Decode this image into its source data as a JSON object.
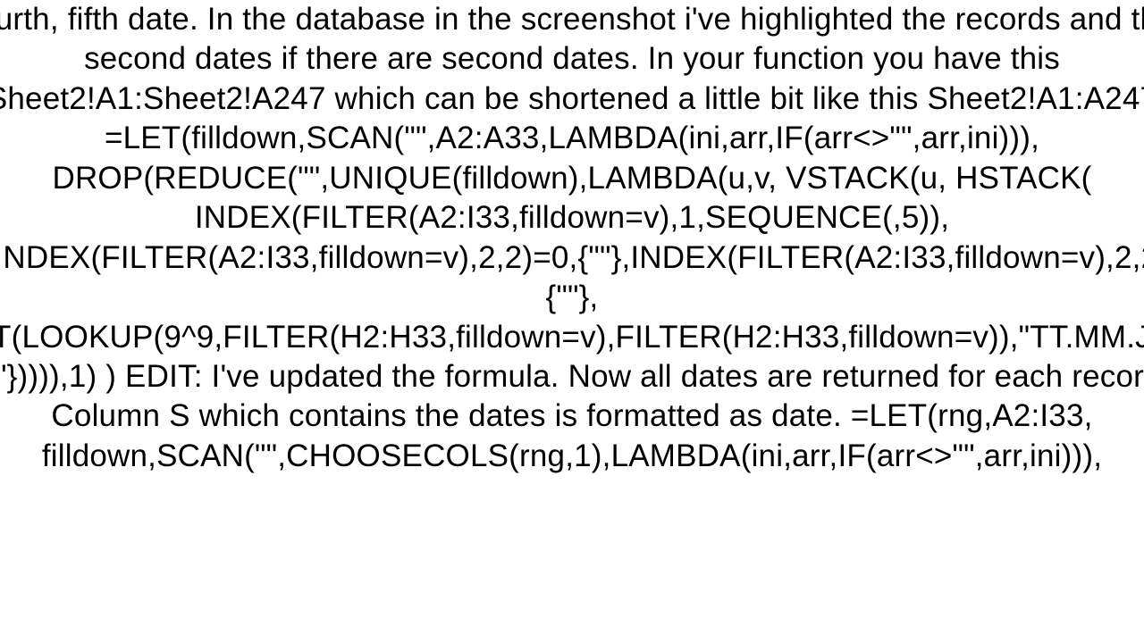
{
  "content": {
    "text": "fourth, fifth date. In the database in the screenshot i've highlighted the records and the second dates if there are second dates. In your function you have this Sheet2!A1:Sheet2!A247 which can be shortened a little bit like this Sheet2!A1:A247 =LET(filldown,SCAN(\"\",A2:A33,LAMBDA(ini,arr,IF(arr<>\"\",arr,ini))), DROP(REDUCE(\"\",UNIQUE(filldown),LAMBDA(u,v, VSTACK(u, HSTACK( INDEX(FILTER(A2:I33,filldown=v),1,SEQUENCE(,5)), IF(INDEX(FILTER(A2:I33,filldown=v),2,2)=0,{\"\"},INDEX(FILTER(A2:I33,filldown=v),2,2)),{\"\"}, TEXT(LOOKUP(9^9,FILTER(H2:H33,filldown=v),FILTER(H2:H33,filldown=v)),\"TT.MM.JJJ\"), {\"\"})))),1)   ) EDIT: I've updated the formula. Now all dates are returned for each record. Column S which contains the dates is formatted as date. =LET(rng,A2:I33, filldown,SCAN(\"\",CHOOSECOLS(rng,1),LAMBDA(ini,arr,IF(arr<>\"\",arr,ini))),"
  }
}
